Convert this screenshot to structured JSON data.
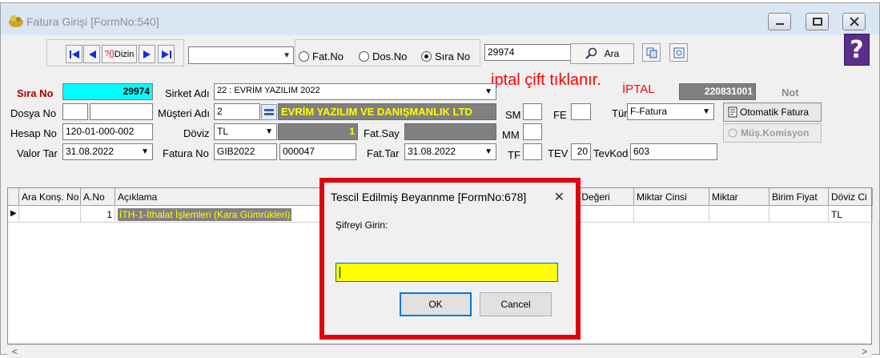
{
  "window": {
    "title": "Fatura Girişi [FormNo:540]",
    "help_label": "?"
  },
  "toolbar": {
    "dizin_label": "Dizin",
    "dizin_prefix": "?{}",
    "search_value": "29974",
    "search_button": "Ara",
    "radios": [
      {
        "label": "Fat.No",
        "selected": false
      },
      {
        "label": "Dos.No",
        "selected": false
      },
      {
        "label": "Sıra No",
        "selected": true
      }
    ]
  },
  "annotation": "iptal çift tıklanır.",
  "form": {
    "sira_no_label": "Sıra No",
    "sira_no_value": "29974",
    "sirket_label": "Sirket Adı",
    "sirket_value": "22 : EVRİM YAZILIM 2022",
    "iptal_label": "İPTAL",
    "iptal_value": "220831001",
    "not_label": "Not",
    "dosya_no_label": "Dosya No",
    "musteri_label": "Müşteri Adı",
    "musteri_code": "2",
    "musteri_name": "EVRİM YAZILIM VE DANIŞMANLIK LTD",
    "sm_label": "SM",
    "fe_label": "FE",
    "tur_label": "Tür",
    "tur_value": "F-Fatura",
    "otomatik_label": "Otomatik Fatura",
    "mus_komisyon_label": "Müş.Komisyon",
    "hesap_no_label": "Hesap No",
    "hesap_no_value": "120-01-000-002",
    "doviz_label": "Döviz",
    "doviz_value": "TL",
    "kur_value": "1",
    "fat_say_label": "Fat.Say",
    "mm_label": "MM",
    "valor_label": "Valor Tar",
    "valor_value": "31.08.2022",
    "fatura_no_label": "Fatura No",
    "fatura_seri": "GIB2022",
    "fatura_no": "000047",
    "fat_tar_label": "Fat.Tar",
    "fat_tar_value": "31.08.2022",
    "tf_label": "TF",
    "tev_label": "TEV",
    "tev_value": "20",
    "tevkod_label": "TevKod",
    "tevkod_value": "603"
  },
  "grid": {
    "columns": [
      "Ara Konş. No",
      "A.No",
      "Açıklama",
      "vz Değeri",
      "Miktar Cinsi",
      "Miktar",
      "Birim Fiyat",
      "Döviz Ci"
    ],
    "rows": [
      {
        "a_no": "1",
        "aciklama": "İTH-1-İthalat İşlemleri  (Kara Gümrükleri)",
        "doviz": "TL"
      }
    ]
  },
  "dialog": {
    "title": "Tescil Edilmiş Beyannme [FormNo:678]",
    "prompt": "Şifreyi Girin:",
    "ok": "OK",
    "cancel": "Cancel"
  },
  "colors": {
    "sira_no_bg": "#00ffff",
    "musteri_bg": "#ffff00",
    "grey_field": "#808080",
    "highlight_red": "#e00010",
    "annotation_red": "#ff0000"
  }
}
